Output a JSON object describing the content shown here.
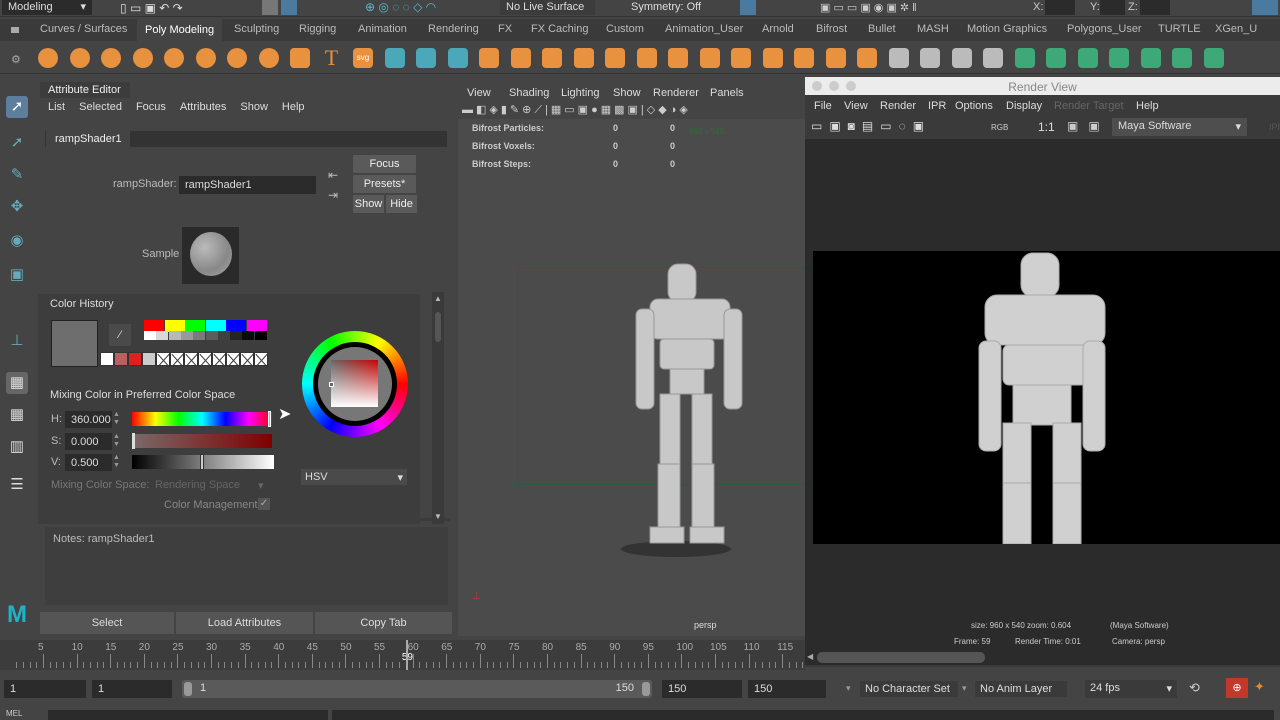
{
  "status_line": {
    "workspace": "Modeling",
    "live_surface": "No Live Surface",
    "symmetry": "Symmetry: Off",
    "x_label": "X:",
    "y_label": "Y:",
    "z_label": "Z:"
  },
  "shelf": {
    "tabs": [
      "Curves / Surfaces",
      "Poly Modeling",
      "Sculpting",
      "Rigging",
      "Animation",
      "Rendering",
      "FX",
      "FX Caching",
      "Custom",
      "Animation_User",
      "Arnold",
      "Bifrost",
      "Bullet",
      "MASH",
      "Motion Graphics",
      "Polygons_User",
      "TURTLE",
      "XGen_U"
    ],
    "active_tab": "Poly Modeling",
    "icons": [
      "poly-sphere-icon",
      "poly-cube-icon",
      "poly-cylinder-icon",
      "poly-cone-icon",
      "poly-torus-icon",
      "poly-plane-icon",
      "poly-disc-icon",
      "platonic-solid-icon",
      "super-shape-icon",
      "type-icon",
      "svg-icon",
      "center-pivot-icon",
      "delete-history-icon",
      "freeze-transform-icon",
      "combine-icon",
      "separate-icon",
      "extract-icon",
      "mirror-icon",
      "smooth-icon",
      "boolean-icon",
      "bridge-icon",
      "bevel-icon",
      "extrude-icon",
      "fill-hole-icon",
      "append-icon",
      "merge-icon",
      "reduce-icon",
      "multi-cut-icon",
      "target-weld-icon",
      "connect-icon",
      "quad-draw-icon",
      "uv-planar-icon",
      "uv-cylindrical-icon",
      "uv-spherical-icon",
      "uv-auto-icon",
      "uv-unfold-icon",
      "uv-editor-icon",
      "uv-layout-icon"
    ],
    "svg_label": "svg",
    "type_label": "T"
  },
  "attribute_editor": {
    "title": "Attribute Editor",
    "menu": [
      "List",
      "Selected",
      "Focus",
      "Attributes",
      "Show",
      "Help"
    ],
    "node_tab": "rampShader1",
    "type_label": "rampShader:",
    "name_value": "rampShader1",
    "focus": "Focus",
    "presets": "Presets*",
    "show": "Show",
    "hide": "Hide",
    "sample_label": "Sample",
    "notes_label": "Notes:  rampShader1",
    "buttons": {
      "select": "Select",
      "load": "Load Attributes",
      "copy": "Copy Tab"
    }
  },
  "color_picker": {
    "history_label": "Color History",
    "current_color": "#6e6e6e",
    "palette_colors": [
      "#ff0000",
      "#ffff00",
      "#00ff00",
      "#00ffff",
      "#0000ff",
      "#ff00ff"
    ],
    "gray_colors": [
      "#ffffff",
      "#d8d8d8",
      "#b8b8b8",
      "#999999",
      "#7a7a7a",
      "#5c5c5c",
      "#404040",
      "#242424",
      "#0a0a0a",
      "#000000"
    ],
    "recent_colors": [
      "#ffffff",
      "#b86060",
      "#e02020",
      "#cccccc"
    ],
    "mixing_label": "Mixing Color in Preferred Color Space",
    "h_label": "H:",
    "h_value": "360.000",
    "s_label": "S:",
    "s_value": "0.000",
    "v_label": "V:",
    "v_value": "0.500",
    "h_fraction": 1.0,
    "s_fraction": 0.0,
    "v_fraction": 0.5,
    "mixing_space_label": "Mixing Color Space:",
    "mixing_space_value": "Rendering Space",
    "color_management": "Color Management",
    "mode": "HSV"
  },
  "viewport": {
    "menu": [
      "View",
      "Shading",
      "Lighting",
      "Show",
      "Renderer",
      "Panels"
    ],
    "stats": [
      {
        "label": "Bifrost Particles:",
        "a": "0",
        "b": "0"
      },
      {
        "label": "Bifrost Voxels:",
        "a": "0",
        "b": "0"
      },
      {
        "label": "Bifrost Steps:",
        "a": "0",
        "b": "0"
      }
    ],
    "resolution": "960 x 540",
    "camera": "persp"
  },
  "render_view": {
    "title": "Render View",
    "menu": [
      "File",
      "View",
      "Render",
      "IPR",
      "Options",
      "Display",
      "Render Target",
      "Help"
    ],
    "rgb": "RGB",
    "ratio": "1:1",
    "renderer": "Maya Software",
    "ipr": "IPR",
    "info_line1": "size: 960 x 540 zoom: 0.604",
    "info_renderer": "(Maya Software)",
    "frame": "Frame: 59",
    "render_time": "Render Time: 0:01",
    "camera": "Camera: persp"
  },
  "timeline": {
    "ticks": [
      "5",
      "10",
      "15",
      "20",
      "25",
      "30",
      "35",
      "40",
      "45",
      "50",
      "55",
      "60",
      "65",
      "70",
      "75",
      "80",
      "85",
      "90",
      "95",
      "100",
      "105",
      "110",
      "115"
    ],
    "current_frame": "59",
    "current_frame_value": 59
  },
  "range": {
    "start": "1",
    "anim_start": "1",
    "slider_start": "1",
    "slider_end": "150",
    "anim_end": "150",
    "end": "150",
    "character_set": "No Character Set",
    "anim_layer": "No Anim Layer",
    "fps": "24 fps"
  },
  "command_line": {
    "label": "MEL"
  }
}
